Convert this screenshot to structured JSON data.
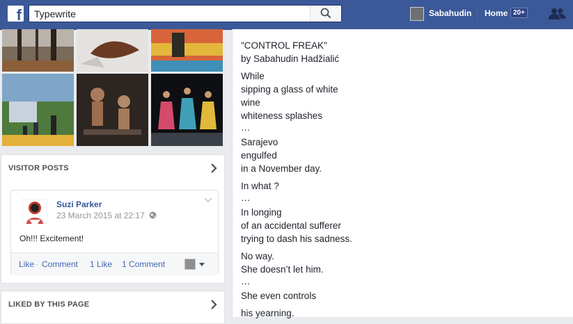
{
  "nav": {
    "search_value": "Typewrite",
    "user_name": "Sabahudin",
    "home_label": "Home",
    "home_count": "20+"
  },
  "visitor_posts": {
    "heading": "VISITOR POSTS",
    "post": {
      "author": "Suzi Parker",
      "date": "23 March 2015 at 22:17",
      "text": "Oh!!! Excitement!",
      "like": "Like",
      "separator": "·",
      "comment": "Comment",
      "likes_count": "1 Like",
      "comments_count": "1 Comment"
    }
  },
  "liked_by": {
    "heading": "LIKED BY THIS PAGE"
  },
  "poem_lines": [
    "\"CONTROL FREAK\"",
    "by Sabahudin Hadžialić",
    "While",
    "sipping a glass of white",
    "wine",
    "whiteness splashes",
    "…",
    "Sarajevo",
    "engulfed",
    "in a November day.",
    "In what ?",
    "…",
    "In longing",
    "of an accidental sufferer",
    "trying to dash his sadness.",
    "No way.",
    "She doesn’t let him.",
    "…",
    "She even controls",
    "his yearning."
  ],
  "colors": {
    "brand_blue": "#3b5998",
    "link_blue": "#365899",
    "page_bg": "#e9ebee"
  }
}
